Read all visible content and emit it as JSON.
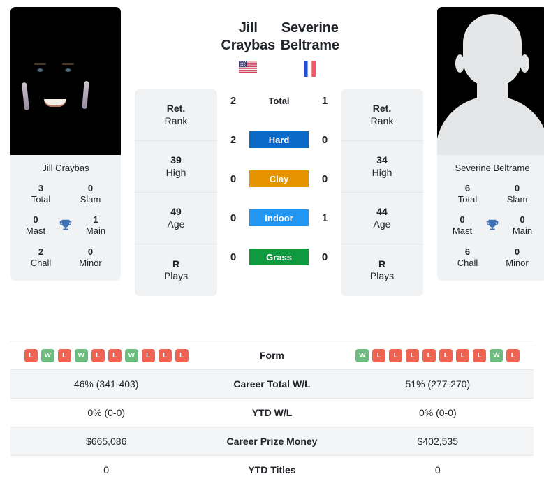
{
  "players": {
    "left": {
      "name": "Jill Craybas",
      "caption": "Jill Craybas",
      "flag": "us-flag-icon",
      "flag_country": "United States",
      "achievements": [
        {
          "value": "3",
          "label": "Total"
        },
        {
          "value": "0",
          "label": "Slam"
        },
        {
          "value": "0",
          "label": "Mast"
        },
        {
          "value": "1",
          "label": "Main"
        },
        {
          "value": "2",
          "label": "Chall"
        },
        {
          "value": "0",
          "label": "Minor"
        }
      ],
      "stats": [
        {
          "value": "Ret.",
          "label": "Rank"
        },
        {
          "value": "39",
          "label": "High"
        },
        {
          "value": "49",
          "label": "Age"
        },
        {
          "value": "R",
          "label": "Plays"
        }
      ],
      "form": [
        "L",
        "W",
        "L",
        "W",
        "L",
        "L",
        "W",
        "L",
        "L",
        "L"
      ],
      "career_total_wl": "46% (341-403)",
      "ytd_wl": "0% (0-0)",
      "career_prize_money": "$665,086",
      "ytd_titles": "0"
    },
    "right": {
      "name": "Severine Beltrame",
      "caption": "Severine Beltrame",
      "flag": "fr-flag-icon",
      "flag_country": "France",
      "achievements": [
        {
          "value": "6",
          "label": "Total"
        },
        {
          "value": "0",
          "label": "Slam"
        },
        {
          "value": "0",
          "label": "Mast"
        },
        {
          "value": "0",
          "label": "Main"
        },
        {
          "value": "6",
          "label": "Chall"
        },
        {
          "value": "0",
          "label": "Minor"
        }
      ],
      "stats": [
        {
          "value": "Ret.",
          "label": "Rank"
        },
        {
          "value": "34",
          "label": "High"
        },
        {
          "value": "44",
          "label": "Age"
        },
        {
          "value": "R",
          "label": "Plays"
        }
      ],
      "form": [
        "W",
        "L",
        "L",
        "L",
        "L",
        "L",
        "L",
        "L",
        "W",
        "L"
      ],
      "career_total_wl": "51% (277-270)",
      "ytd_wl": "0% (0-0)",
      "career_prize_money": "$402,535",
      "ytd_titles": "0"
    }
  },
  "head_to_head": {
    "rows": [
      {
        "left": "2",
        "label": "Total",
        "right": "1",
        "badge": false,
        "color": ""
      },
      {
        "left": "2",
        "label": "Hard",
        "right": "0",
        "badge": true,
        "color": "#0b69c7"
      },
      {
        "left": "0",
        "label": "Clay",
        "right": "0",
        "badge": true,
        "color": "#e59400"
      },
      {
        "left": "0",
        "label": "Indoor",
        "right": "1",
        "badge": true,
        "color": "#2196f3"
      },
      {
        "left": "0",
        "label": "Grass",
        "right": "0",
        "badge": true,
        "color": "#109a3f"
      }
    ]
  },
  "comparison_table": {
    "rows": [
      {
        "label": "Form",
        "type": "form"
      },
      {
        "label": "Career Total W/L",
        "type": "text",
        "key": "career_total_wl"
      },
      {
        "label": "YTD W/L",
        "type": "text",
        "key": "ytd_wl"
      },
      {
        "label": "Career Prize Money",
        "type": "text",
        "key": "career_prize_money"
      },
      {
        "label": "YTD Titles",
        "type": "text",
        "key": "ytd_titles"
      }
    ]
  },
  "colors": {
    "hard": "#0b69c7",
    "clay": "#e59400",
    "indoor": "#2196f3",
    "grass": "#109a3f",
    "win": "#6cbb7f",
    "loss": "#ee6352",
    "trophy": "#3f72b4",
    "panel": "#f1f2f3"
  },
  "icons": {
    "trophy": "trophy-icon"
  }
}
